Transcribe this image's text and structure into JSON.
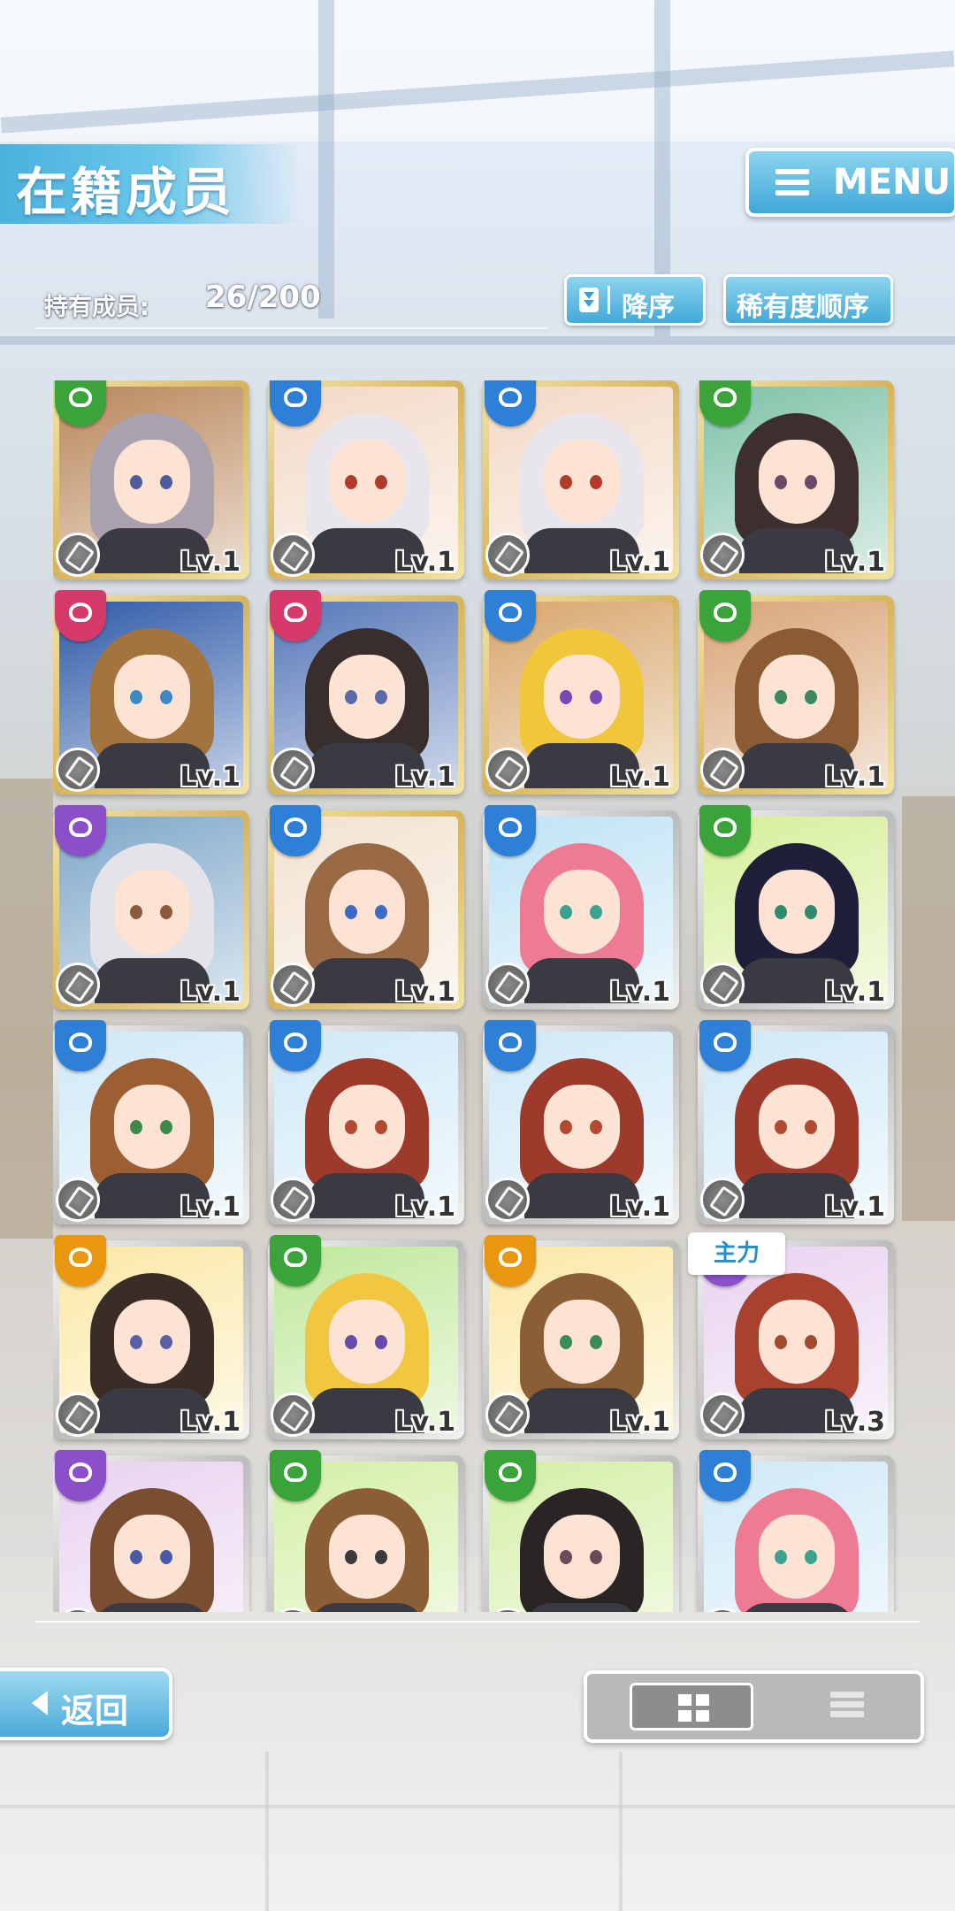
{
  "header": {
    "title": "在籍成员",
    "menu_label": "MENU"
  },
  "toolbar": {
    "count_label": "持有成员:",
    "count_value": "26/200",
    "order_label": "降序",
    "rarity_label": "稀有度顺序"
  },
  "main_tag": "主力",
  "cards": [
    {
      "level": "Lv.1",
      "frame": "gold",
      "attr": "green",
      "hair": "#a9a1ad",
      "bg": "#b9875a",
      "eyes": "#4c5b9c",
      "icon": "wind-icon"
    },
    {
      "level": "Lv.1",
      "frame": "gold",
      "attr": "blue",
      "hair": "#e8e6ec",
      "bg": "#f3d9c6",
      "eyes": "#b03b2a",
      "icon": "whip-icon"
    },
    {
      "level": "Lv.1",
      "frame": "gold",
      "attr": "blue",
      "hair": "#e8e6ec",
      "bg": "#f3d9c6",
      "eyes": "#b03b2a",
      "icon": "whip-icon"
    },
    {
      "level": "Lv.1",
      "frame": "gold",
      "attr": "green",
      "hair": "#3c2f2e",
      "bg": "#7fc2a8",
      "eyes": "#6b4a68",
      "icon": "wind-icon"
    },
    {
      "level": "Lv.1",
      "frame": "gold",
      "attr": "pink",
      "hair": "#a4743f",
      "bg": "#2f5aa8",
      "eyes": "#3c8ac4",
      "icon": "rocket-icon"
    },
    {
      "level": "Lv.1",
      "frame": "gold",
      "attr": "pink",
      "hair": "#3a2e2c",
      "bg": "#5677b8",
      "eyes": "#5a6aa6",
      "icon": "rocket-icon"
    },
    {
      "level": "Lv.1",
      "frame": "gold",
      "attr": "blue",
      "hair": "#f0c63a",
      "bg": "#d8a66c",
      "eyes": "#7a49b6",
      "icon": "spear-icon"
    },
    {
      "level": "Lv.1",
      "frame": "gold",
      "attr": "green",
      "hair": "#8c5a33",
      "bg": "#d9a577",
      "eyes": "#3c8a62",
      "icon": "hammer-icon"
    },
    {
      "level": "Lv.1",
      "frame": "gold",
      "attr": "purple",
      "hair": "#e5e3ea",
      "bg": "#7ea7c9",
      "eyes": "#8a5a3a",
      "icon": "whip-icon"
    },
    {
      "level": "Lv.1",
      "frame": "gold",
      "attr": "blue",
      "hair": "#9a6a45",
      "bg": "#f2e2d0",
      "eyes": "#3c6ac4",
      "icon": "spear-icon"
    },
    {
      "level": "Lv.1",
      "frame": "silver",
      "attr": "blue",
      "hair": "#ef7a94",
      "bg": "#bfe3f5",
      "eyes": "#3aa28f",
      "icon": "hammer-icon"
    },
    {
      "level": "Lv.1",
      "frame": "silver",
      "attr": "green",
      "hair": "#1f1f3a",
      "bg": "#d6ef9a",
      "eyes": "#2f8a70",
      "icon": "spear-icon"
    },
    {
      "level": "Lv.1",
      "frame": "silver",
      "attr": "blue",
      "hair": "#9c5f34",
      "bg": "#cfe9f7",
      "eyes": "#3b8a4a",
      "icon": "hammer-icon"
    },
    {
      "level": "Lv.1",
      "frame": "silver",
      "attr": "blue",
      "hair": "#9e3a2c",
      "bg": "#cfe9f7",
      "eyes": "#b14a2f",
      "icon": "spear-icon"
    },
    {
      "level": "Lv.1",
      "frame": "silver",
      "attr": "blue",
      "hair": "#9e3a2c",
      "bg": "#cfe9f7",
      "eyes": "#b14a2f",
      "icon": "spear-icon"
    },
    {
      "level": "Lv.1",
      "frame": "silver",
      "attr": "blue",
      "hair": "#9e3a2c",
      "bg": "#cfe9f7",
      "eyes": "#b14a2f",
      "icon": "spear-icon"
    },
    {
      "level": "Lv.1",
      "frame": "silver",
      "attr": "orange",
      "hair": "#3a2c26",
      "bg": "#fbe8a6",
      "eyes": "#5a5fa8",
      "icon": "spear-icon"
    },
    {
      "level": "Lv.1",
      "frame": "silver",
      "attr": "green",
      "hair": "#f1c640",
      "bg": "#bfe89a",
      "eyes": "#6a4aa8",
      "icon": "spear-icon"
    },
    {
      "level": "Lv.1",
      "frame": "silver",
      "attr": "orange",
      "hair": "#8c5e35",
      "bg": "#fbe8a6",
      "eyes": "#3b8a5a",
      "icon": "hammer-icon"
    },
    {
      "level": "Lv.3",
      "frame": "silver",
      "attr": "purple",
      "hair": "#a8412e",
      "bg": "#e9d2f0",
      "eyes": "#a14a2f",
      "icon": "spear-icon"
    },
    {
      "level": "",
      "frame": "silver",
      "attr": "purple",
      "hair": "#7a4e30",
      "bg": "#e9d2f0",
      "eyes": "#4a5aa8",
      "icon": "spear-icon"
    },
    {
      "level": "",
      "frame": "silver",
      "attr": "green",
      "hair": "#8c5e35",
      "bg": "#d4efa6",
      "eyes": "#3b3b3b",
      "icon": "spear-icon"
    },
    {
      "level": "",
      "frame": "silver",
      "attr": "green",
      "hair": "#2a2424",
      "bg": "#d4efa6",
      "eyes": "#6a4a5a",
      "icon": "spear-icon"
    },
    {
      "level": "",
      "frame": "silver",
      "attr": "blue",
      "hair": "#ef7a94",
      "bg": "#cfe9f7",
      "eyes": "#3aa28f",
      "icon": "spear-icon"
    }
  ],
  "footer": {
    "back_label": "返回"
  }
}
